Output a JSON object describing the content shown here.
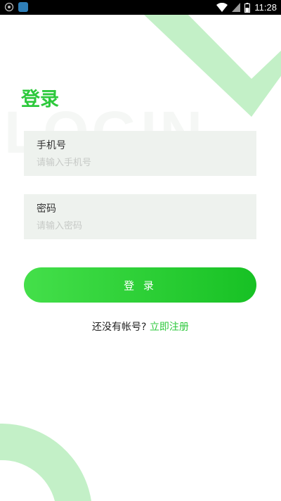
{
  "status_bar": {
    "time": "11:28",
    "icons": [
      "notification-icon",
      "app-icon",
      "wifi-icon",
      "signal-icon",
      "battery-icon"
    ]
  },
  "colors": {
    "accent": "#2dc93c",
    "decor": "#c3f0c7",
    "field_bg": "#eef2ee",
    "button_start": "#44df4a",
    "button_end": "#17c124"
  },
  "page": {
    "title": "登录",
    "watermark": "LOGIN"
  },
  "form": {
    "phone": {
      "label": "手机号",
      "placeholder": "请输入手机号",
      "value": ""
    },
    "password": {
      "label": "密码",
      "placeholder": "请输入密码",
      "value": ""
    },
    "submit_label": "登 录"
  },
  "register": {
    "prompt": "还没有帐号?",
    "link": "立即注册"
  }
}
